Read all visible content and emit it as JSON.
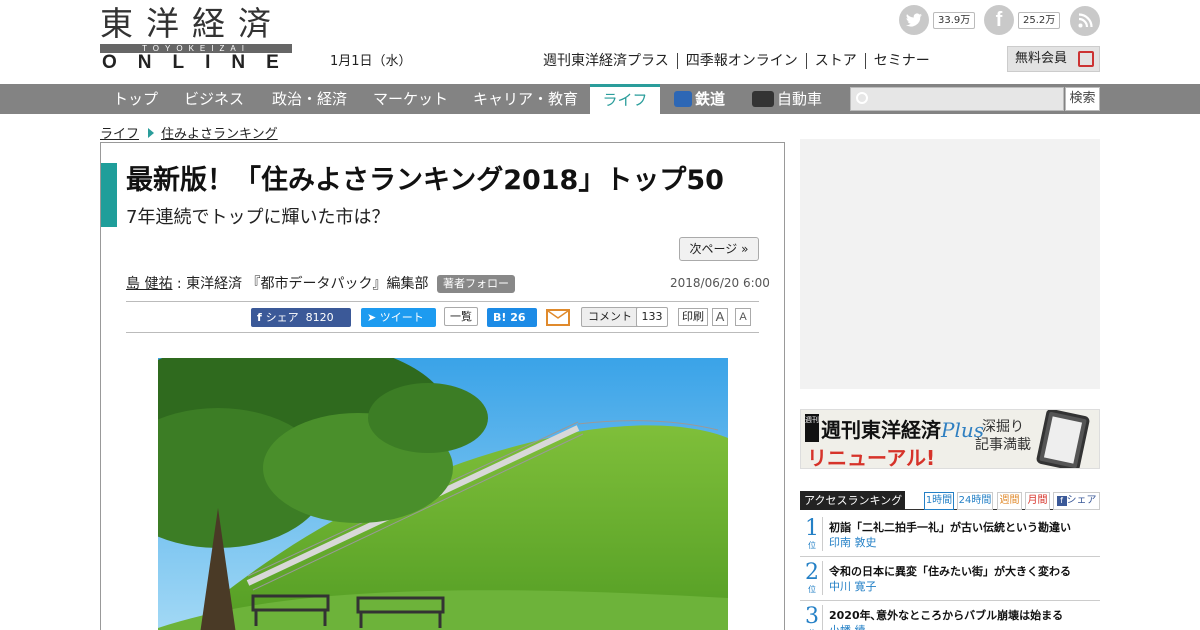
{
  "header": {
    "logo_kanji": "東洋経済",
    "logo_roman": "TOYOKEIZAI",
    "logo_online": "ONLINE",
    "date": "1月1日（水）",
    "twitter_count": "33.9万",
    "facebook_count": "25.2万",
    "links": [
      "週刊東洋経済プラス",
      "四季報オンライン",
      "ストア",
      "セミナー"
    ],
    "free_member": "無料会員"
  },
  "nav": {
    "items": [
      "トップ",
      "ビジネス",
      "政治・経済",
      "マーケット",
      "キャリア・教育",
      "ライフ",
      "鉄道",
      "自動車"
    ],
    "active": "ライフ",
    "accent_color": "#2a9d9b",
    "search_placeholder": "",
    "search_button": "検索"
  },
  "breadcrumb": [
    "ライフ",
    "住みよさランキング"
  ],
  "article": {
    "title": "最新版！「住みよさランキング2018」トップ50",
    "subtitle": "7年連続でトップに輝いた市は？",
    "next_page": "次ページ »",
    "author": "島 健祐",
    "affiliation": ": 東洋経済 『都市データパック』編集部",
    "follow": "著者フォロー",
    "date": "2018/06/20 6:00",
    "share": {
      "fb_label": "シェア",
      "fb_count": "8120",
      "tweet_label": "ツイート",
      "list_label": "一覧",
      "hatena_label": "B!",
      "hatena_count": "26",
      "comment_label": "コメント",
      "comment_count": "133",
      "print_label": "印刷",
      "font_small": "A",
      "font_large": "A"
    }
  },
  "sidebar": {
    "banner_title": "週刊東洋経済",
    "banner_plus": "Plus",
    "banner_renew": "リニューアル!",
    "banner_side": "深掘り 記事満載",
    "banner_tag": "週刊",
    "ranking_title": "アクセスランキング",
    "ranking_tabs": [
      "1時間",
      "24時間",
      "週間",
      "月間",
      "シェア"
    ],
    "ranking": [
      {
        "rank": "1",
        "unit": "位",
        "headline": "初詣「二礼二拍手一礼」が古い伝統という勘違い",
        "author": "印南 敦史"
      },
      {
        "rank": "2",
        "unit": "位",
        "headline": "令和の日本に異変「住みたい街」が大きく変わる",
        "author": "中川 寛子"
      },
      {
        "rank": "3",
        "unit": "位",
        "headline": "2020年､意外なところからバブル崩壊は始まる",
        "author": "小幡 績"
      }
    ]
  }
}
